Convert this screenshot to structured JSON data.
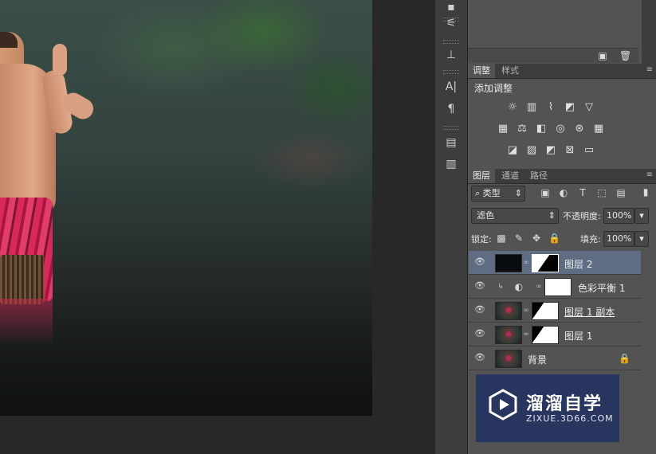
{
  "adjustments_panel": {
    "tabs": [
      "调整",
      "样式"
    ],
    "heading": "添加调整",
    "icons_row1": [
      "brightness-icon",
      "levels-icon",
      "curves-icon",
      "exposure-icon",
      "vibrance-icon"
    ],
    "icons_row2": [
      "hue-saturation-icon",
      "color-balance-icon",
      "black-white-icon",
      "photo-filter-icon",
      "channel-mixer-icon",
      "color-lookup-icon"
    ],
    "icons_row3": [
      "invert-icon",
      "posterize-icon",
      "threshold-icon",
      "selective-color-icon",
      "gradient-map-icon"
    ]
  },
  "layers_panel": {
    "tabs": [
      "图层",
      "通道",
      "路径"
    ],
    "filter_kind": "类型",
    "blend_mode": "滤色",
    "opacity_label": "不透明度:",
    "opacity_value": "100%",
    "lock_label": "锁定:",
    "fill_label": "填充:",
    "fill_value": "100%",
    "layers": [
      {
        "name": "图层 2",
        "selected": true
      },
      {
        "name": "色彩平衡 1",
        "selected": false
      },
      {
        "name": "图层 1 副本",
        "selected": false
      },
      {
        "name": "图层 1",
        "selected": false
      },
      {
        "name": "背景",
        "selected": false
      }
    ]
  },
  "watermark": {
    "title": "溜溜自学",
    "url": "ZIXUE.3D66.COM"
  },
  "colors": {
    "panel_bg": "#535353",
    "selected_layer": "#5f6d84",
    "watermark_bg": "#27355f"
  }
}
